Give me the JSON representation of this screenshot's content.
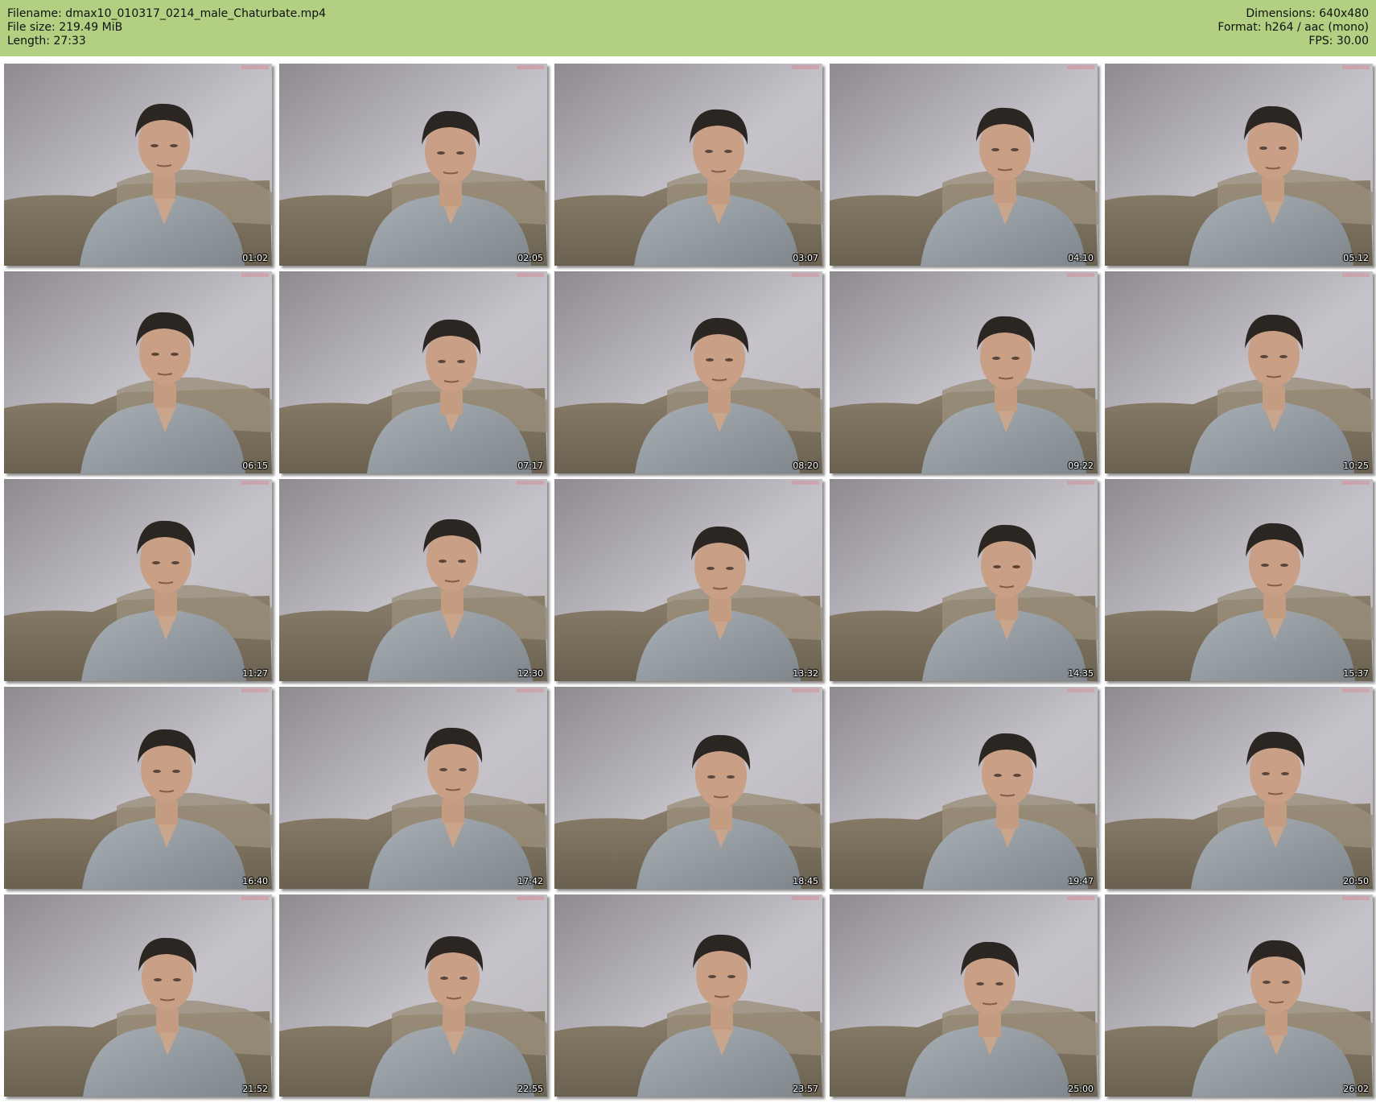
{
  "header": {
    "filename_label": "Filename: dmax10_010317_0214_male_Chaturbate.mp4",
    "filesize_label": "File size: 219.49 MiB",
    "length_label": "Length: 27:33",
    "dimensions_label": "Dimensions: 640x480",
    "format_label": "Format: h264 / aac (mono)",
    "fps_label": "FPS: 30.00",
    "background_color": "#b2cf82"
  },
  "thumbnails": [
    {
      "time": "01:02"
    },
    {
      "time": "02:05"
    },
    {
      "time": "03:07"
    },
    {
      "time": "04:10"
    },
    {
      "time": "05:12"
    },
    {
      "time": "06:15"
    },
    {
      "time": "07:17"
    },
    {
      "time": "08:20"
    },
    {
      "time": "09:22"
    },
    {
      "time": "10:25"
    },
    {
      "time": "11:27"
    },
    {
      "time": "12:30"
    },
    {
      "time": "13:32"
    },
    {
      "time": "14:35"
    },
    {
      "time": "15:37"
    },
    {
      "time": "16:40"
    },
    {
      "time": "17:42"
    },
    {
      "time": "18:45"
    },
    {
      "time": "19:47"
    },
    {
      "time": "20:50"
    },
    {
      "time": "21:52"
    },
    {
      "time": "22:55"
    },
    {
      "time": "23:57"
    },
    {
      "time": "25:00"
    },
    {
      "time": "26:02"
    }
  ]
}
